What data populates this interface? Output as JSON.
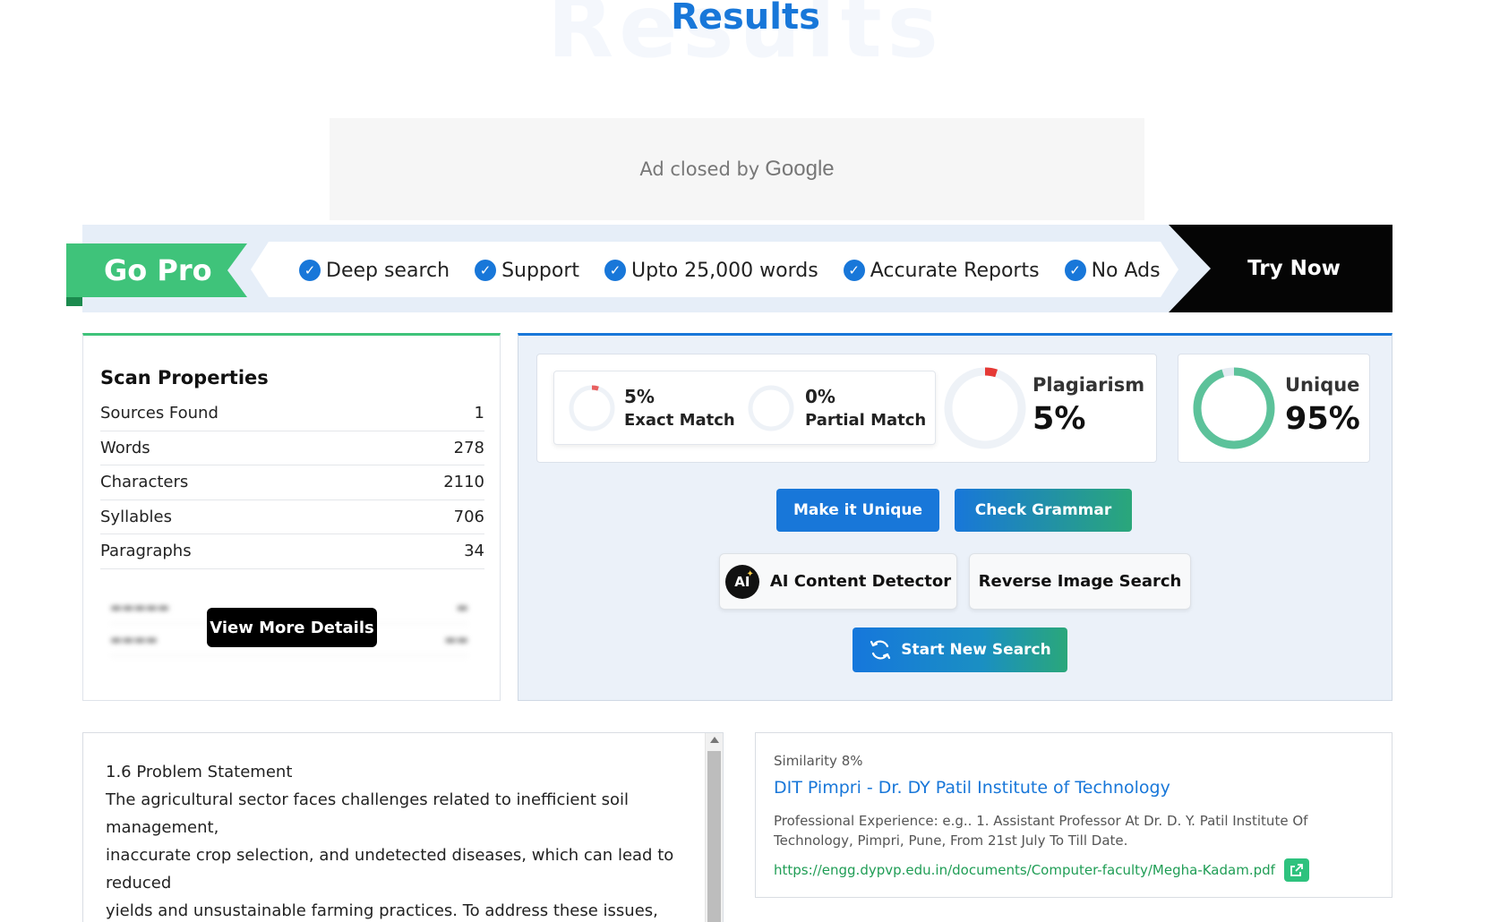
{
  "header": {
    "bg_word": "Results",
    "title": "Results"
  },
  "ad": {
    "text": "Ad closed by",
    "brand": "Google"
  },
  "pro_banner": {
    "badge": "Go Pro",
    "features": [
      "Deep search",
      "Support",
      "Upto 25,000 words",
      "Accurate Reports",
      "No Ads"
    ],
    "cta": "Try Now"
  },
  "scan_properties": {
    "title": "Scan Properties",
    "rows": [
      {
        "label": "Sources Found",
        "value": "1"
      },
      {
        "label": "Words",
        "value": "278"
      },
      {
        "label": "Characters",
        "value": "2110"
      },
      {
        "label": "Syllables",
        "value": "706"
      },
      {
        "label": "Paragraphs",
        "value": "34"
      }
    ],
    "view_more": "View More Details"
  },
  "results": {
    "exact_match": {
      "percent": "5%",
      "label": "Exact Match",
      "fraction": 0.05
    },
    "partial_match": {
      "percent": "0%",
      "label": "Partial Match",
      "fraction": 0
    },
    "plagiarism": {
      "label": "Plagiarism",
      "value": "5%",
      "fraction": 0.05
    },
    "unique": {
      "label": "Unique",
      "value": "95%",
      "fraction": 0.95
    },
    "buttons": {
      "make_unique": "Make it Unique",
      "check_grammar": "Check Grammar",
      "ai_detector": "AI Content Detector",
      "ai_icon_text": "AI",
      "reverse_image": "Reverse Image Search",
      "start_new": "Start New Search"
    }
  },
  "text_panel": {
    "lines": [
      "1.6 Problem Statement",
      "The agricultural sector faces challenges related to inefficient soil management,",
      "inaccurate crop selection, and undetected diseases, which can lead to reduced",
      "yields and unsustainable farming practices. To address these issues,"
    ]
  },
  "source": {
    "similarity": "Similarity 8%",
    "title": "DIT Pimpri - Dr. DY Patil Institute of Technology",
    "description": "Professional Experience: e.g.. 1. Assistant Professor At Dr. D. Y. Patil Institute Of Technology, Pimpri, Pune, From 21st July To Till Date.",
    "url": "https://engg.dypvp.edu.in/documents/Computer-faculty/Megha-Kadam.pdf"
  },
  "colors": {
    "accent_blue": "#1877d9",
    "green": "#3fc37a",
    "plagiarism_red": "#e53935",
    "unique_green": "#5cc29a"
  }
}
